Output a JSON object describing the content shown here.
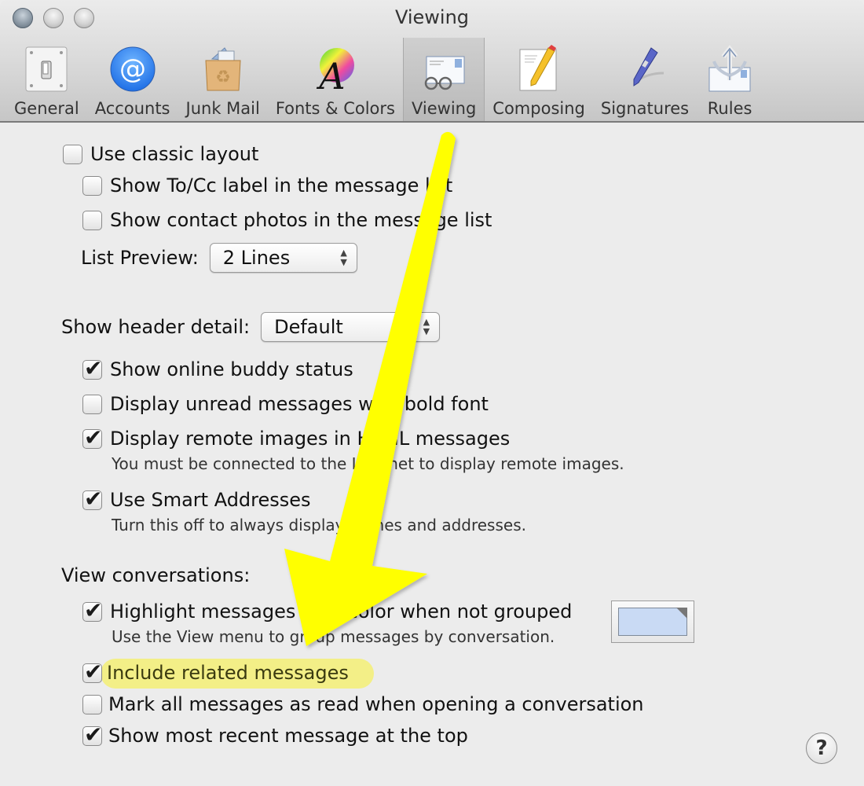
{
  "window": {
    "title": "Viewing",
    "traffic_lights": [
      "close",
      "minimize",
      "zoom"
    ]
  },
  "toolbar": {
    "items": [
      {
        "label": "General",
        "icon": "light-switch-icon",
        "active": false
      },
      {
        "label": "Accounts",
        "icon": "at-sign-icon",
        "active": false
      },
      {
        "label": "Junk Mail",
        "icon": "junk-bag-icon",
        "active": false
      },
      {
        "label": "Fonts & Colors",
        "icon": "font-color-wheel-icon",
        "active": false
      },
      {
        "label": "Viewing",
        "icon": "glasses-letter-icon",
        "active": true
      },
      {
        "label": "Composing",
        "icon": "pencil-paper-icon",
        "active": false
      },
      {
        "label": "Signatures",
        "icon": "pen-icon",
        "active": false
      },
      {
        "label": "Rules",
        "icon": "rules-arrows-icon",
        "active": false
      }
    ]
  },
  "layout": {
    "use_classic_layout": {
      "label": "Use classic layout",
      "checked": false
    },
    "show_to_cc": {
      "label": "Show To/Cc label in the message list",
      "checked": false
    },
    "show_contact_photos": {
      "label": "Show contact photos in the message list",
      "checked": false
    },
    "list_preview": {
      "label": "List Preview:",
      "value": "2 Lines"
    }
  },
  "header": {
    "label": "Show header detail:",
    "value": "Default",
    "show_buddy_status": {
      "label": "Show online buddy status",
      "checked": true
    },
    "bold_unread": {
      "label": "Display unread messages with bold font",
      "checked": false
    },
    "remote_images": {
      "label": "Display remote images in HTML messages",
      "checked": true,
      "note": "You must be connected to the Internet to display remote images."
    },
    "smart_addresses": {
      "label": "Use Smart Addresses",
      "checked": true,
      "note": "Turn this off to always display names and addresses."
    }
  },
  "conversations": {
    "label": "View conversations:",
    "highlight_color": {
      "label": "Highlight messages with color when not grouped",
      "checked": true,
      "note": "Use the View menu to group messages by conversation.",
      "color": "#c9daf4"
    },
    "include_related": {
      "label": "Include related messages",
      "checked": true,
      "highlighted": true
    },
    "mark_read": {
      "label": "Mark all messages as read when opening a conversation",
      "checked": false
    },
    "most_recent_top": {
      "label": "Show most recent message at the top",
      "checked": true
    }
  },
  "help": {
    "label": "?"
  },
  "annotation": {
    "type": "arrow",
    "color": "#ffff00",
    "highlight_color": "#f3ef87"
  }
}
